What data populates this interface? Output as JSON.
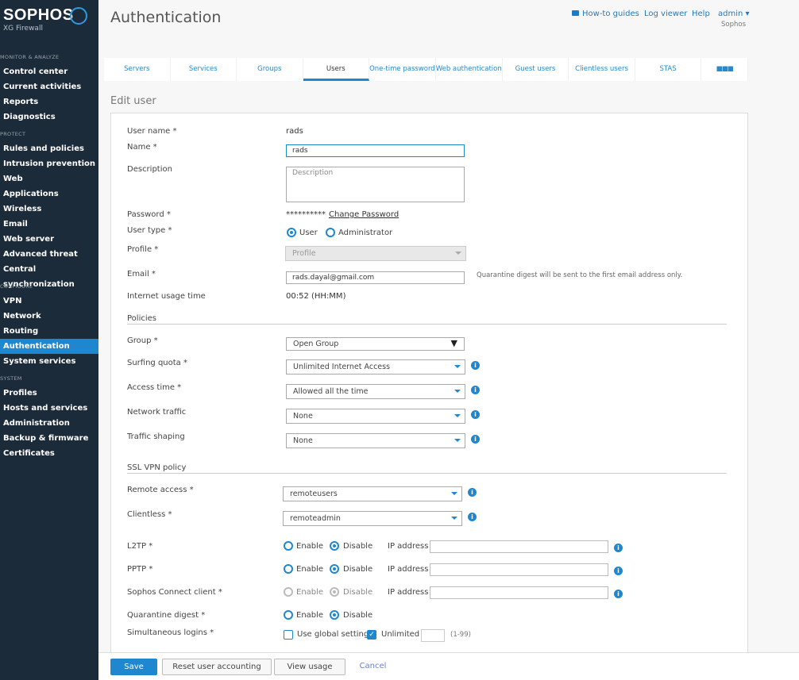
{
  "brand": {
    "name": "SOPHOS",
    "product": "XG Firewall"
  },
  "sidebar": {
    "sections": [
      {
        "title": "MONITOR & ANALYZE",
        "items": [
          "Control center",
          "Current activities",
          "Reports",
          "Diagnostics"
        ]
      },
      {
        "title": "PROTECT",
        "items": [
          "Rules and policies",
          "Intrusion prevention",
          "Web",
          "Applications",
          "Wireless",
          "Email",
          "Web server",
          "Advanced threat",
          "Central synchronization"
        ]
      },
      {
        "title": "CONFIGURE",
        "items": [
          "VPN",
          "Network",
          "Routing",
          "Authentication",
          "System services"
        ]
      },
      {
        "title": "SYSTEM",
        "items": [
          "Profiles",
          "Hosts and services",
          "Administration",
          "Backup & firmware",
          "Certificates"
        ]
      }
    ],
    "active": "Authentication"
  },
  "header": {
    "title": "Authentication",
    "howto": "How-to guides",
    "log": "Log viewer",
    "help": "Help",
    "user": "admin",
    "org": "Sophos"
  },
  "tabs": [
    "Servers",
    "Services",
    "Groups",
    "Users",
    "One-time password",
    "Web authentication",
    "Guest users",
    "Clientless users",
    "STAS"
  ],
  "form": {
    "heading": "Edit user",
    "username_label": "User name *",
    "username": "rads",
    "name_label": "Name *",
    "name": "rads",
    "desc_label": "Description",
    "desc_placeholder": "Description",
    "password_label": "Password *",
    "password": "**********",
    "change_password": "Change Password",
    "usertype_label": "User type *",
    "usertype_user": "User",
    "usertype_admin": "Administrator",
    "profile_label": "Profile *",
    "profile": "Profile",
    "email_label": "Email *",
    "email": "rads.dayal@gmail.com",
    "email_note": "Quarantine digest will be sent to the first email address only.",
    "usage_label": "Internet usage time",
    "usage": "00:52 (HH:MM)",
    "policies": "Policies",
    "group_label": "Group *",
    "group": "Open Group",
    "quota_label": "Surfing quota *",
    "quota": "Unlimited Internet Access",
    "access_label": "Access time *",
    "access": "Allowed all the time",
    "traffic_label": "Network traffic",
    "traffic": "None",
    "shaping_label": "Traffic shaping",
    "shaping": "None",
    "sslvpn": "SSL VPN policy",
    "remote_label": "Remote access *",
    "remote": "remoteusers",
    "clientless_label": "Clientless *",
    "clientless": "remoteadmin",
    "l2tp_label": "L2TP *",
    "pptp_label": "PPTP *",
    "sophos_label": "Sophos Connect client *",
    "quarantine_label": "Quarantine digest *",
    "enable": "Enable",
    "disable": "Disable",
    "ip": "IP address",
    "simul_label": "Simultaneous logins *",
    "global": "Use global setting",
    "unlimited": "Unlimited",
    "range": "(1-99)"
  },
  "footer": {
    "save": "Save",
    "reset": "Reset user accounting",
    "view": "View usage",
    "cancel": "Cancel"
  }
}
